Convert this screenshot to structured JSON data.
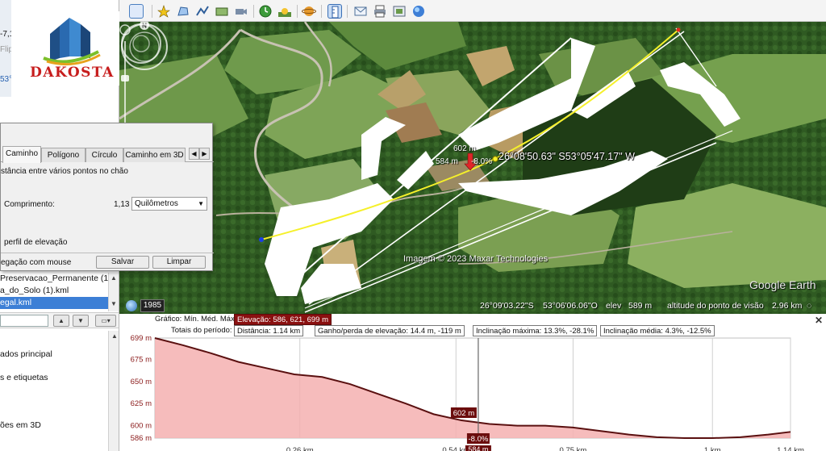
{
  "sidebar": {
    "top_fragments": [
      "-7,1",
      "Flip",
      "53°"
    ],
    "places_items": [
      "Preservacao_Permanente (1)...",
      "a_do_Solo (1).kml",
      "egal.kml"
    ],
    "layers_items": [
      "ados principal",
      "s e etiquetas",
      "ões em 3D"
    ]
  },
  "logo": {
    "text": "DAKOSTA"
  },
  "ruler": {
    "tabs": [
      "Caminho",
      "Polígono",
      "Círculo",
      "Caminho em 3D"
    ],
    "active_tab": "Caminho",
    "description": "stância entre vários pontos no chão",
    "length_label": "Comprimento:",
    "length_value": "1,13",
    "unit": "Quilômetros",
    "profile_label": "perfil de elevação",
    "mouse_label": "egação com mouse",
    "save_button": "Salvar",
    "clear_button": "Limpar"
  },
  "map": {
    "cursor_coord": "26°08'50.63\" S53°05'47.17\" W",
    "pin_elevation": "602 m",
    "pin_elevation_low": "584 m",
    "pin_slope": "-8.0%",
    "credit": "Imagem © 2023 Maxar Technologies",
    "brand": "Google Earth",
    "imagery_year": "1985",
    "status": {
      "lat": "26°09'03.22\"S",
      "lon": "53°06'06.06\"O",
      "elev_label": "elev",
      "elev_value": "589 m",
      "eye_label": "altitude do ponto de visão",
      "eye_value": "2.96 km"
    },
    "compass_north": "N",
    "colors": {
      "path": "#f5f02a",
      "overlay": "#ffffff"
    }
  },
  "profile": {
    "header": {
      "graph_label": "Gráfico:",
      "graph_options": "Mín. Méd. Máx",
      "elevation_box": "Elevação: 586, 621, 699 m",
      "totals_label": "Totais do período:",
      "distance_box": "Distância: 1.14 km",
      "gain_box": "Ganho/perda de elevação: 14.4 m, -119 m",
      "max_slope_box": "Inclinação máxima: 13.3%, -28.1%",
      "avg_slope_box": "Inclinação média: 4.3%, -12.5%"
    },
    "marker_elevation": "602 m",
    "marker_slope": "-8.0%",
    "marker_distance": "584 m",
    "close_icon": "close-icon",
    "chart_data": {
      "type": "area",
      "title": "",
      "xlabel": "",
      "ylabel": "",
      "x_unit": "km",
      "xlim": [
        0,
        1.14
      ],
      "ylim": [
        586,
        699
      ],
      "y_tick_labels": [
        "699 m",
        "675 m",
        "650 m",
        "625 m",
        "600 m",
        "586 m"
      ],
      "y_ticks": [
        699,
        675,
        650,
        625,
        600,
        586
      ],
      "x_tick_labels": [
        "0.26 km",
        "0.54 km",
        "0.75 km",
        "1 km",
        "1.14 km"
      ],
      "x_ticks": [
        0.26,
        0.54,
        0.75,
        1.0,
        1.14
      ],
      "series": [
        {
          "x": [
            0,
            0.05,
            0.1,
            0.15,
            0.2,
            0.25,
            0.3,
            0.35,
            0.4,
            0.45,
            0.5,
            0.55,
            0.6,
            0.65,
            0.7,
            0.75,
            0.8,
            0.85,
            0.9,
            0.95,
            1.0,
            1.05,
            1.1,
            1.14
          ],
          "y": [
            699,
            691,
            682,
            672,
            665,
            658,
            655,
            647,
            636,
            625,
            613,
            606,
            602,
            600,
            600,
            598,
            594,
            590,
            587,
            586,
            586,
            587,
            590,
            593
          ]
        }
      ],
      "cursor_x": 0.58,
      "colors": {
        "fill": "#f4b0b0",
        "line": "#5a1010",
        "marker": "#6b0d0d"
      }
    }
  }
}
